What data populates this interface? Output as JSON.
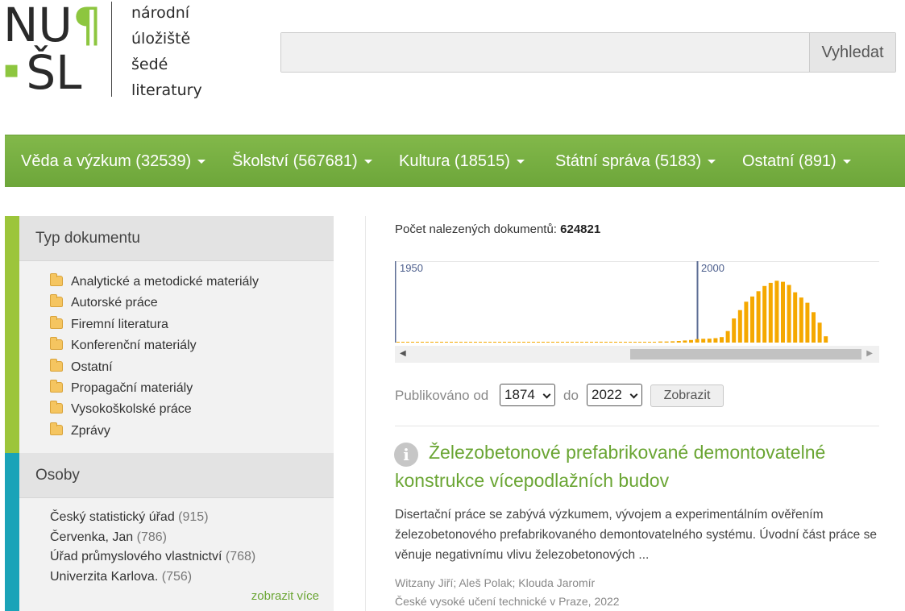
{
  "logo": {
    "mark_line1": "NU",
    "mark_pilcrow": "¶",
    "mark_line2": "ŠL",
    "text_lines": [
      "národní",
      "úložiště",
      "šedé",
      "literatury"
    ]
  },
  "search": {
    "placeholder": "",
    "value": "",
    "button_label": "Vyhledat"
  },
  "nav": {
    "items": [
      {
        "label": "Věda a výzkum (32539)"
      },
      {
        "label": "Školství (567681)"
      },
      {
        "label": "Kultura (18515)"
      },
      {
        "label": "Státní správa (5183)"
      },
      {
        "label": "Ostatní (891)"
      }
    ]
  },
  "facets": {
    "doc_type": {
      "title": "Typ dokumentu",
      "accent": "#9cc53b",
      "items": [
        "Analytické a metodické materiály",
        "Autorské práce",
        "Firemní literatura",
        "Konferenční materiály",
        "Ostatní",
        "Propagační materiály",
        "Vysokoškolské práce",
        "Zprávy"
      ]
    },
    "persons": {
      "title": "Osoby",
      "accent": "#1aa3b8",
      "items": [
        {
          "name": "Český statistický úřad",
          "count": "(915)"
        },
        {
          "name": "Červenka, Jan",
          "count": "(786)"
        },
        {
          "name": "Úřad průmyslového vlastnictví",
          "count": "(768)"
        },
        {
          "name": "Univerzita Karlova.",
          "count": "(756)"
        }
      ],
      "more": "zobrazit více"
    }
  },
  "results": {
    "count_label": "Počet nalezených dokumentů:",
    "count_value": "624821"
  },
  "timeline": {
    "label_1950": "1950",
    "label_2000": "2000",
    "bar_color": "#f5a800",
    "scroll_left_arrow": "◀",
    "scroll_right_arrow": "▶"
  },
  "chart_data": {
    "type": "bar",
    "title": "",
    "x": [
      1950,
      2000
    ],
    "series": [
      {
        "values_from_1993": [
          1,
          1,
          1.2,
          1.5,
          2,
          2.5,
          3.3,
          3.6,
          3.8,
          4.2,
          5.2,
          11,
          23,
          31,
          39,
          44,
          49,
          54,
          57,
          59,
          58,
          55,
          48,
          43,
          38,
          29,
          19,
          6
        ]
      }
    ],
    "ylim": [
      0,
      60
    ]
  },
  "filter": {
    "from_label": "Publikováno od",
    "from_value": "1874",
    "to_label": "do",
    "to_value": "2022",
    "button_label": "Zobrazit"
  },
  "result": {
    "icon_letter": "i",
    "title": "Železobetonové prefabrikované demontovatelné konstrukce vícepodlažních budov",
    "description": "Disertační práce se zabývá výzkumem, vývojem a experimentálním ověřením železobetonového prefabrikovaného demontovatelného systému. Úvodní část práce se věnuje negativnímu vlivu železobetonových ...",
    "authors": "Witzany Jiří; Aleš Polak; Klouda Jaromír",
    "publisher": "České vysoké učení technické v Praze, 2022"
  }
}
